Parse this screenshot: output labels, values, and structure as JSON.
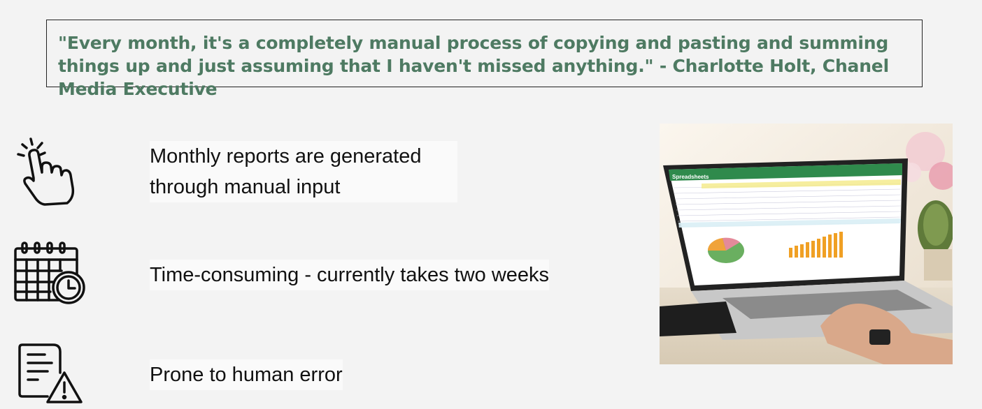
{
  "quote": {
    "text": "\"Every month, it's a completely manual process of copying and pasting and summing things up and just assuming that I haven't missed anything.\" - Charlotte Holt, Chanel Media Executive",
    "color": "#4e7a62"
  },
  "points": [
    {
      "icon": "hand-tap-icon",
      "text": "Monthly reports are generated through manual input"
    },
    {
      "icon": "calendar-clock-icon",
      "text": "Time-consuming - currently takes two weeks"
    },
    {
      "icon": "document-warning-icon",
      "text": "Prone to human error"
    }
  ],
  "photo": {
    "screen_title": "Spreadsheets",
    "description_icon": "laptop-spreadsheet-photo"
  }
}
